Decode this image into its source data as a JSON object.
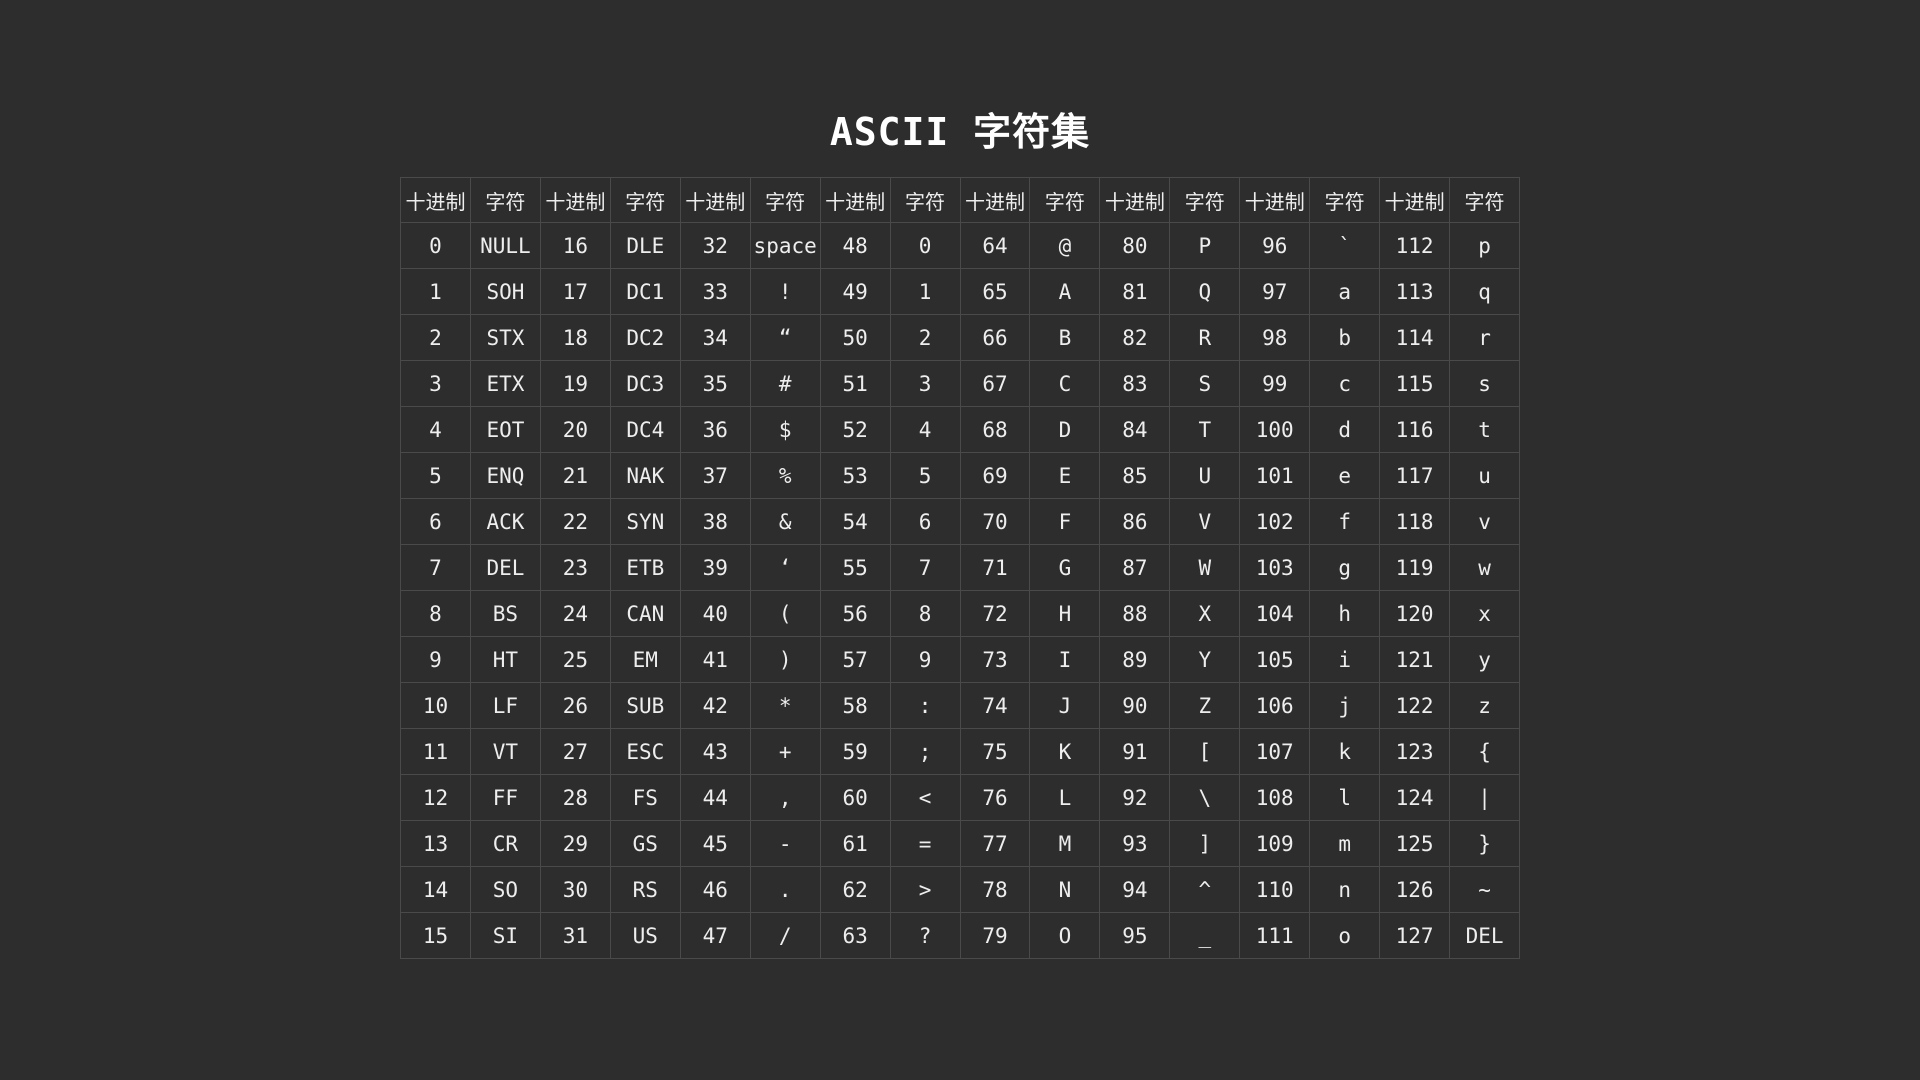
{
  "title": "ASCII 字符集",
  "headers": [
    "十进制",
    "字符",
    "十进制",
    "字符",
    "十进制",
    "字符",
    "十进制",
    "字符",
    "十进制",
    "字符",
    "十进制",
    "字符",
    "十进制",
    "字符",
    "十进制",
    "字符"
  ],
  "rows": [
    [
      "0",
      "NULL",
      "16",
      "DLE",
      "32",
      "space",
      "48",
      "0",
      "64",
      "@",
      "80",
      "P",
      "96",
      "`",
      "112",
      "p"
    ],
    [
      "1",
      "SOH",
      "17",
      "DC1",
      "33",
      "!",
      "49",
      "1",
      "65",
      "A",
      "81",
      "Q",
      "97",
      "a",
      "113",
      "q"
    ],
    [
      "2",
      "STX",
      "18",
      "DC2",
      "34",
      "“",
      "50",
      "2",
      "66",
      "B",
      "82",
      "R",
      "98",
      "b",
      "114",
      "r"
    ],
    [
      "3",
      "ETX",
      "19",
      "DC3",
      "35",
      "#",
      "51",
      "3",
      "67",
      "C",
      "83",
      "S",
      "99",
      "c",
      "115",
      "s"
    ],
    [
      "4",
      "EOT",
      "20",
      "DC4",
      "36",
      "$",
      "52",
      "4",
      "68",
      "D",
      "84",
      "T",
      "100",
      "d",
      "116",
      "t"
    ],
    [
      "5",
      "ENQ",
      "21",
      "NAK",
      "37",
      "%",
      "53",
      "5",
      "69",
      "E",
      "85",
      "U",
      "101",
      "e",
      "117",
      "u"
    ],
    [
      "6",
      "ACK",
      "22",
      "SYN",
      "38",
      "&",
      "54",
      "6",
      "70",
      "F",
      "86",
      "V",
      "102",
      "f",
      "118",
      "v"
    ],
    [
      "7",
      "DEL",
      "23",
      "ETB",
      "39",
      "‘",
      "55",
      "7",
      "71",
      "G",
      "87",
      "W",
      "103",
      "g",
      "119",
      "w"
    ],
    [
      "8",
      "BS",
      "24",
      "CAN",
      "40",
      "(",
      "56",
      "8",
      "72",
      "H",
      "88",
      "X",
      "104",
      "h",
      "120",
      "x"
    ],
    [
      "9",
      "HT",
      "25",
      "EM",
      "41",
      ")",
      "57",
      "9",
      "73",
      "I",
      "89",
      "Y",
      "105",
      "i",
      "121",
      "y"
    ],
    [
      "10",
      "LF",
      "26",
      "SUB",
      "42",
      "*",
      "58",
      ":",
      "74",
      "J",
      "90",
      "Z",
      "106",
      "j",
      "122",
      "z"
    ],
    [
      "11",
      "VT",
      "27",
      "ESC",
      "43",
      "+",
      "59",
      ";",
      "75",
      "K",
      "91",
      "[",
      "107",
      "k",
      "123",
      "{"
    ],
    [
      "12",
      "FF",
      "28",
      "FS",
      "44",
      ",",
      "60",
      "<",
      "76",
      "L",
      "92",
      "\\",
      "108",
      "l",
      "124",
      "|"
    ],
    [
      "13",
      "CR",
      "29",
      "GS",
      "45",
      "-",
      "61",
      "=",
      "77",
      "M",
      "93",
      "]",
      "109",
      "m",
      "125",
      "}"
    ],
    [
      "14",
      "SO",
      "30",
      "RS",
      "46",
      ".",
      "62",
      ">",
      "78",
      "N",
      "94",
      "^",
      "110",
      "n",
      "126",
      "~"
    ],
    [
      "15",
      "SI",
      "31",
      "US",
      "47",
      "/",
      "63",
      "?",
      "79",
      "O",
      "95",
      "_",
      "111",
      "o",
      "127",
      "DEL"
    ]
  ],
  "colors": {
    "background": "#2d2d2d",
    "text": "#eeeeee",
    "border": "#4a4a4a"
  }
}
